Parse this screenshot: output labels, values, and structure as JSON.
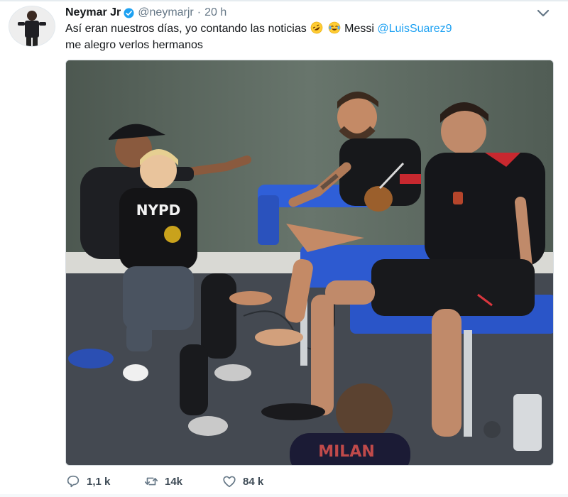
{
  "tweet": {
    "display_name": "Neymar Jr",
    "handle": "@neymarjr",
    "separator": "·",
    "time": "20 h",
    "text_line1_a": "Así eran nuestros días, yo contando las noticias",
    "text_line1_b": "Messi",
    "mention": "@LuisSuarez9",
    "text_line2": "me alegro verlos hermanos",
    "emojis": [
      "rolling-on-floor-laughing-emoji",
      "face-with-tears-of-joy-emoji"
    ],
    "verified_icon": "verified-badge-icon",
    "menu_icon": "chevron-down-icon"
  },
  "media": {
    "kind": "photo",
    "jersey_text_child": "NYPD",
    "jersey_text_boy": "MILAN"
  },
  "actions": {
    "replies": "1,1 k",
    "retweets": "14k",
    "likes": "84 k",
    "icons": [
      "reply-icon",
      "retweet-icon",
      "like-icon"
    ]
  },
  "colors": {
    "link": "#1da1f2",
    "meta": "#657786",
    "verified": "#1da1f2",
    "couch": "#2f5fd8",
    "wall": "#5f6b63"
  }
}
